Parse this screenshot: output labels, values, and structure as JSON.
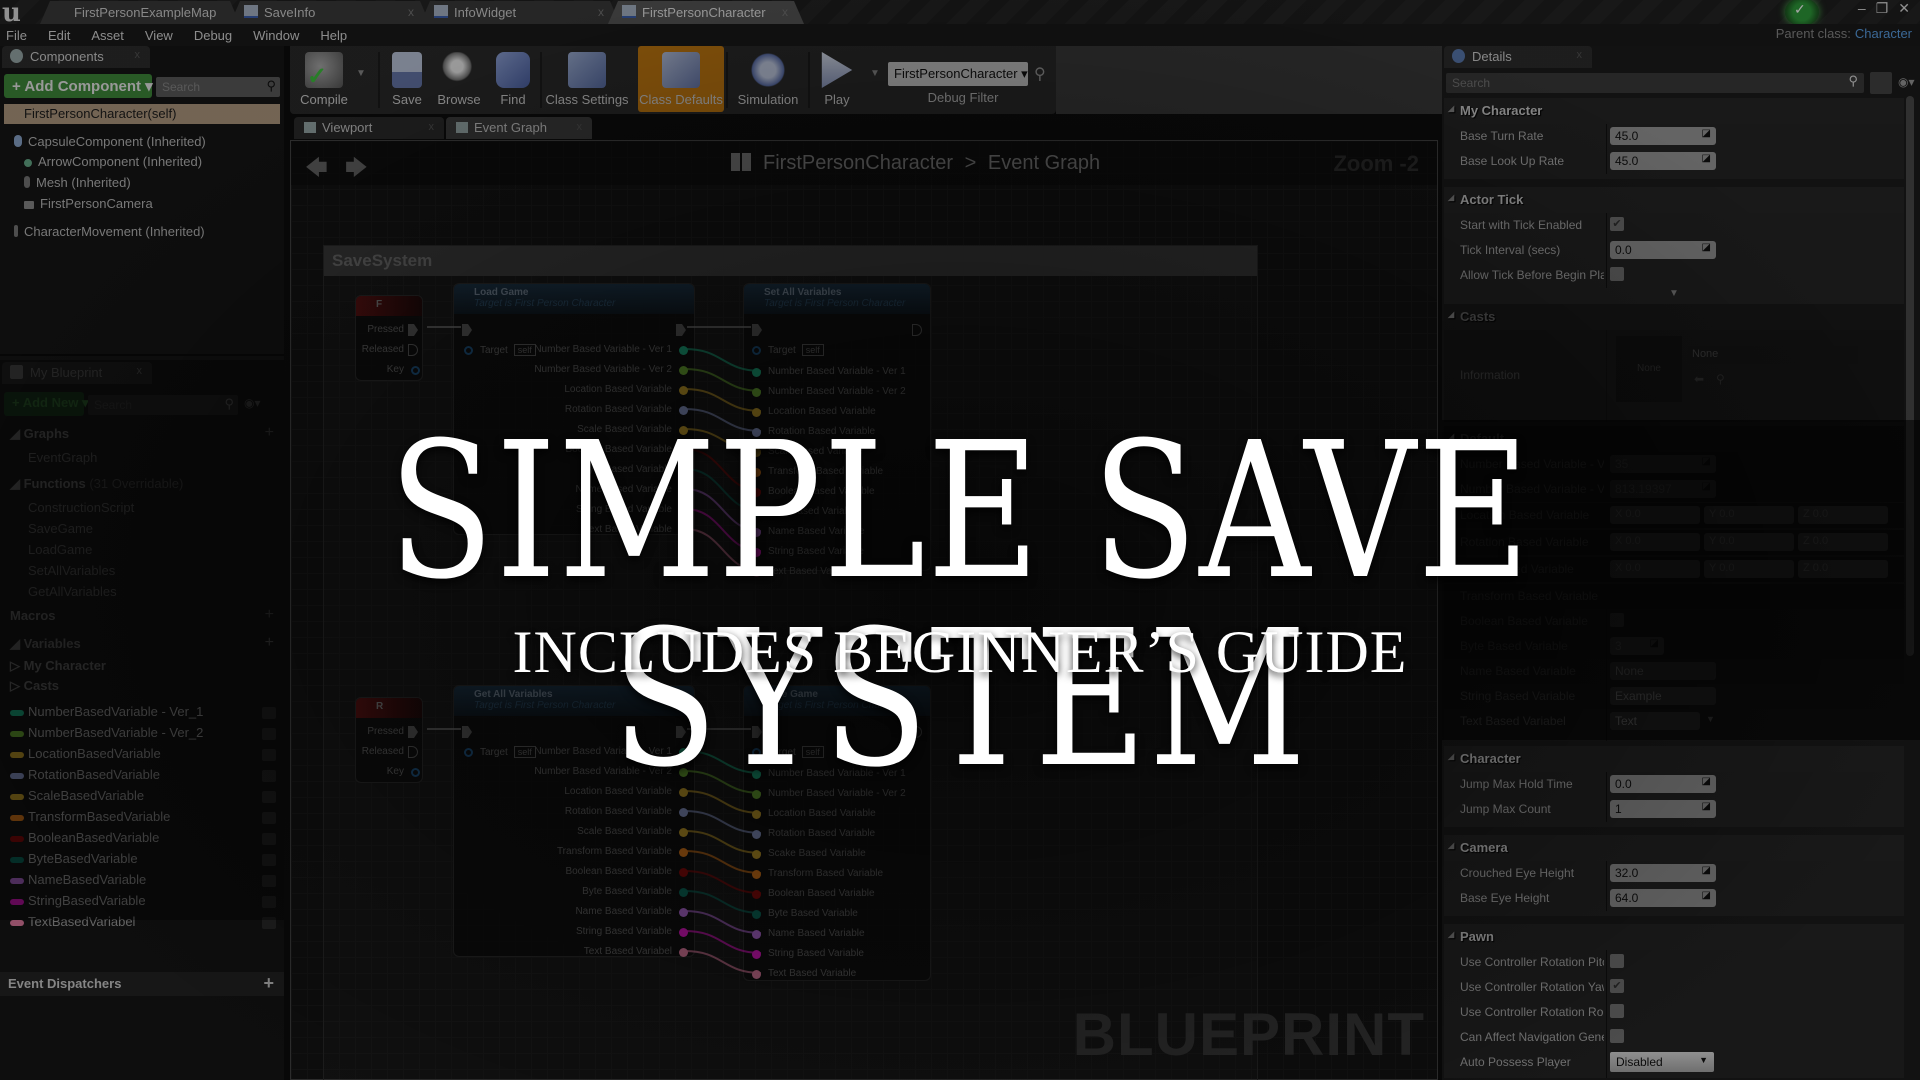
{
  "titlebar": {
    "tabs": [
      {
        "label": "FirstPersonExampleMap",
        "active": false
      },
      {
        "label": "SaveInfo",
        "active": false
      },
      {
        "label": "InfoWidget",
        "active": false
      },
      {
        "label": "FirstPersonCharacter",
        "active": true
      }
    ],
    "window_buttons": [
      "–",
      "❐",
      "✕"
    ]
  },
  "menubar": {
    "items": [
      "File",
      "Edit",
      "Asset",
      "View",
      "Debug",
      "Window",
      "Help"
    ],
    "parent_class_label": "Parent class:",
    "parent_class_value": "Character"
  },
  "components": {
    "tab_label": "Components",
    "add_button": "+ Add Component ▾",
    "search_placeholder": "Search",
    "self_item": "FirstPersonCharacter(self)",
    "items": [
      "CapsuleComponent (Inherited)",
      "ArrowComponent (Inherited)",
      "Mesh (Inherited)",
      "FirstPersonCamera",
      "CharacterMovement (Inherited)"
    ]
  },
  "my_blueprint": {
    "tab_label": "My Blueprint",
    "add_button": "+ Add New ▾",
    "search_placeholder": "Search",
    "graphs_header": "Graphs",
    "graphs": [
      "EventGraph"
    ],
    "functions_header": "Functions",
    "functions_note": "(31 Overridable)",
    "functions": [
      "ConstructionScript",
      "SaveGame",
      "LoadGame",
      "SetAllVariables",
      "GetAllVariables"
    ],
    "macros_header": "Macros",
    "variables_header": "Variables",
    "variable_groups": [
      "My Character",
      "Casts"
    ],
    "variables": [
      {
        "name": "NumberBasedVariable - Ver_1",
        "color": "#1aa57a"
      },
      {
        "name": "NumberBasedVariable - Ver_2",
        "color": "#6aa832"
      },
      {
        "name": "LocationBasedVariable",
        "color": "#c7a02a"
      },
      {
        "name": "RotationBasedVariable",
        "color": "#8c9acc"
      },
      {
        "name": "ScaleBasedVariable",
        "color": "#c7a02a"
      },
      {
        "name": "TransformBasedVariable",
        "color": "#e07b1a"
      },
      {
        "name": "BooleanBasedVariable",
        "color": "#8c0a0a"
      },
      {
        "name": "ByteBasedVariable",
        "color": "#0b6b5c"
      },
      {
        "name": "NameBasedVariable",
        "color": "#b36ad6"
      },
      {
        "name": "StringBasedVariable",
        "color": "#e316c8"
      },
      {
        "name": "TextBasedVariabel",
        "color": "#e07ba0"
      }
    ],
    "event_dispatchers": "Event Dispatchers"
  },
  "toolbar": {
    "buttons": [
      "Compile",
      "Save",
      "Browse",
      "Find",
      "Class Settings",
      "Class Defaults",
      "Simulation",
      "Play"
    ],
    "active": "Class Defaults",
    "debug_filter_value": "FirstPersonCharacter",
    "debug_filter_label": "Debug Filter"
  },
  "graph_tabs": [
    {
      "label": "Viewport",
      "active": false
    },
    {
      "label": "Event Graph",
      "active": true
    }
  ],
  "graph": {
    "breadcrumb_root": "FirstPersonCharacter",
    "breadcrumb_sep": ">",
    "breadcrumb_leaf": "Event Graph",
    "zoom": "Zoom -2",
    "comment_title": "SaveSystem",
    "watermark": "BLUEPRINT",
    "key_f": {
      "key": "F",
      "pins": [
        "Pressed",
        "Released",
        "Key"
      ]
    },
    "key_r": {
      "key": "R",
      "pins": [
        "Pressed",
        "Released",
        "Key"
      ]
    },
    "target_note": "Target is First Person Character",
    "target_label": "Target",
    "self_label": "self",
    "load_game": {
      "title": "Load Game",
      "outputs": [
        "Number Based Variable - Ver 1",
        "Number Based Variable - Ver 2",
        "Location Based Variable",
        "Rotation Based Variable",
        "Scale Based Variable",
        "Boolean Based Variable",
        "Byte Based Variable",
        "Name Based Variable",
        "String Based Variable",
        "Text Based Variable"
      ]
    },
    "set_all": {
      "title": "Set All Variables",
      "inputs": [
        "Number Based Variable - Ver 1",
        "Number Based Variable - Ver 2",
        "Location Based Variable",
        "Rotation Based Variable",
        "Scale Based Variable",
        "Transform Based Variable",
        "Boolean Based Variable",
        "Byte Based Variable",
        "Name Based Variable",
        "String Based Variable",
        "Text Based Variable"
      ]
    },
    "get_all": {
      "title": "Get All Variables",
      "outputs": [
        "Number Based Variable - Ver 1",
        "Number Based Variable - Ver 2",
        "Location Based Variable",
        "Rotation Based Variable",
        "Scale Based Variable",
        "Transform Based Variable",
        "Boolean Based Variable",
        "Byte Based Variable",
        "Name Based Variable",
        "String Based Variable",
        "Text Based Variabel"
      ]
    },
    "save_game": {
      "title": "Save Game",
      "inputs": [
        "Number Based Variable - Ver 1",
        "Number Based Variable - Ver 2",
        "Location Based Variable",
        "Rotation Based Variable",
        "Scake Based Variable",
        "Transform Based Variable",
        "Boolean Based Variable",
        "Byte Based Variable",
        "Name Based Variable",
        "String Based Variable",
        "Text Based Variable"
      ]
    },
    "pin_colors": [
      "#1aa57a",
      "#6aa832",
      "#c7a02a",
      "#8c9acc",
      "#c7a02a",
      "#e07b1a",
      "#8c0a0a",
      "#0b6b5c",
      "#b36ad6",
      "#e316c8",
      "#e07ba0"
    ]
  },
  "details": {
    "tab_label": "Details",
    "search_placeholder": "Search",
    "my_character": {
      "header": "My Character",
      "rows": [
        {
          "label": "Base Turn Rate",
          "value": "45.0"
        },
        {
          "label": "Base Look Up Rate",
          "value": "45.0"
        }
      ]
    },
    "actor_tick": {
      "header": "Actor Tick",
      "start_with_tick": {
        "label": "Start with Tick Enabled",
        "checked": true
      },
      "tick_interval": {
        "label": "Tick Interval (secs)",
        "value": "0.0"
      },
      "allow_tick": {
        "label": "Allow Tick Before Begin Play",
        "checked": false
      }
    },
    "casts": {
      "header": "Casts",
      "label": "Information",
      "thumb": "None",
      "select": "None"
    },
    "default": {
      "header": "Default",
      "num1": {
        "label": "Number Based Variable - Ver 1",
        "value": "35"
      },
      "num2": {
        "label": "Number Based Variable - Ver 2",
        "value": "813.19397"
      },
      "location": {
        "label": "Location Based Variable",
        "x": "X 0.0",
        "y": "Y 0.0",
        "z": "Z 0.0"
      },
      "rotation": {
        "label": "Rotation Based Variable",
        "x": "X 0.0",
        "y": "Y 0.0",
        "z": "Z 0.0"
      },
      "scale": {
        "label": "Scale Based Variable",
        "x": "X 0.0",
        "y": "Y 0.0",
        "z": "Z 0.0"
      },
      "transform": {
        "label": "Transform Based Variable"
      },
      "boolean": {
        "label": "Boolean Based Variable",
        "checked": true
      },
      "byte": {
        "label": "Byte Based Variable",
        "value": "3"
      },
      "name": {
        "label": "Name Based Variable",
        "value": "None"
      },
      "string": {
        "label": "String Based Variable",
        "value": "Example"
      },
      "text": {
        "label": "Text Based Variabel",
        "value": "Text"
      }
    },
    "character": {
      "header": "Character",
      "rows": [
        {
          "label": "Jump Max Hold Time",
          "value": "0.0"
        },
        {
          "label": "Jump Max Count",
          "value": "1"
        }
      ]
    },
    "camera": {
      "header": "Camera",
      "rows": [
        {
          "label": "Crouched Eye Height",
          "value": "32.0"
        },
        {
          "label": "Base Eye Height",
          "value": "64.0"
        }
      ]
    },
    "pawn": {
      "header": "Pawn",
      "pitch": {
        "label": "Use Controller Rotation Pitch",
        "checked": false
      },
      "yaw": {
        "label": "Use Controller Rotation Yaw",
        "checked": true
      },
      "roll": {
        "label": "Use Controller Rotation Roll",
        "checked": false
      },
      "nav": {
        "label": "Can Affect Navigation Generation",
        "checked": false
      },
      "auto_possess": {
        "label": "Auto Possess Player",
        "value": "Disabled"
      }
    }
  },
  "overlay": {
    "headline": "SIMPLE SAVE SYSTEM",
    "subline": "INCLUDES BEGINNER’S GUIDE"
  }
}
